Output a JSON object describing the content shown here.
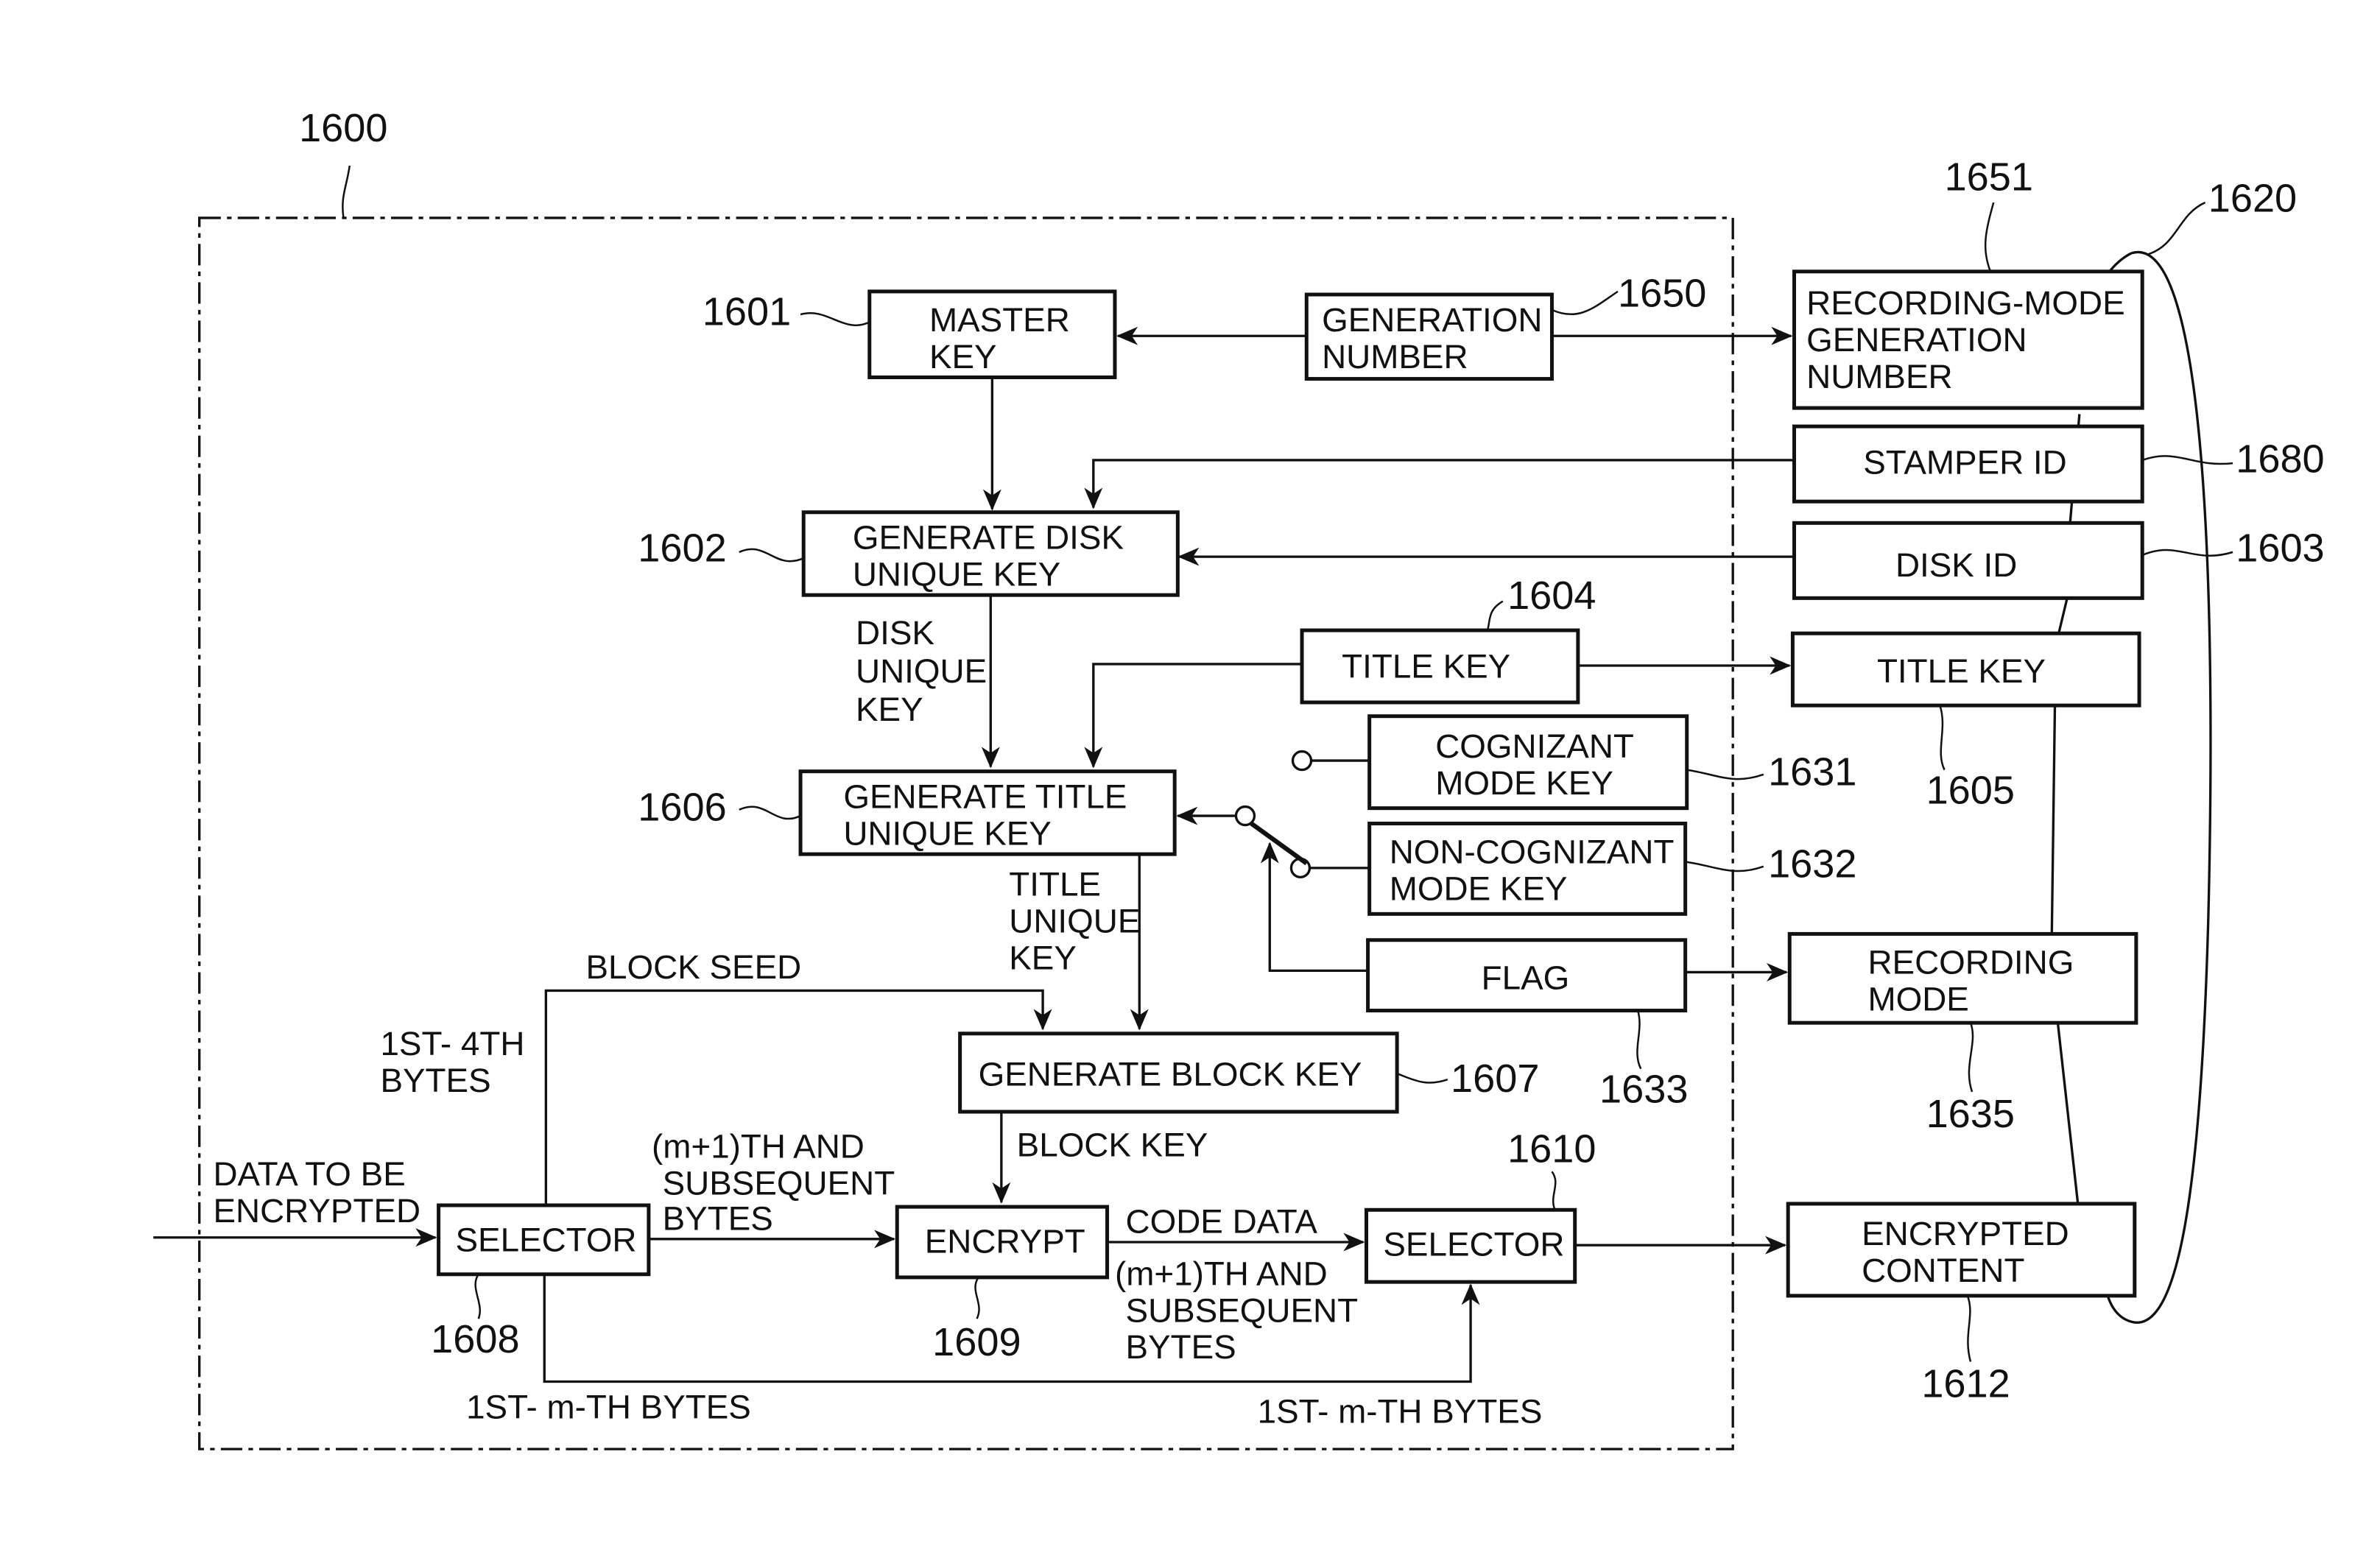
{
  "figure": {
    "container_ref": "1600",
    "disk_ref": "1620"
  },
  "blocks": {
    "master_key": {
      "lines": [
        "MASTER",
        "KEY"
      ],
      "ref": "1601"
    },
    "generation_number": {
      "lines": [
        "GENERATION",
        "NUMBER"
      ],
      "ref": "1650"
    },
    "gen_disk_unique_key": {
      "lines": [
        "GENERATE DISK",
        "UNIQUE KEY"
      ],
      "ref": "1602"
    },
    "title_key_inner": {
      "lines": [
        "TITLE  KEY"
      ],
      "ref": "1604"
    },
    "gen_title_unique_key": {
      "lines": [
        "GENERATE TITLE",
        "UNIQUE KEY"
      ],
      "ref": "1606"
    },
    "cognizant_mode_key": {
      "lines": [
        "COGNIZANT",
        "MODE KEY"
      ],
      "ref": "1631"
    },
    "non_cognizant_mode_key": {
      "lines": [
        "NON-COGNIZANT",
        "MODE KEY"
      ],
      "ref": "1632"
    },
    "flag": {
      "lines": [
        "FLAG"
      ],
      "ref": "1633"
    },
    "gen_block_key": {
      "lines": [
        "GENERATE BLOCK KEY"
      ],
      "ref": "1607"
    },
    "selector_in": {
      "lines": [
        "SELECTOR"
      ],
      "ref": "1608"
    },
    "encrypt": {
      "lines": [
        "ENCRYPT"
      ],
      "ref": "1609"
    },
    "selector_out": {
      "lines": [
        "SELECTOR"
      ],
      "ref": "1610"
    }
  },
  "disk_fields": {
    "recording_mode_generation_number": {
      "lines": [
        "RECORDING-MODE",
        "GENERATION",
        "NUMBER"
      ],
      "ref": "1651"
    },
    "stamper_id": {
      "lines": [
        "STAMPER ID"
      ],
      "ref": "1680"
    },
    "disk_id": {
      "lines": [
        "DISK ID"
      ],
      "ref": "1603"
    },
    "title_key": {
      "lines": [
        "TITLE KEY"
      ],
      "ref": "1605"
    },
    "recording_mode": {
      "lines": [
        "RECORDING",
        "MODE"
      ],
      "ref": "1635"
    },
    "encrypted_content": {
      "lines": [
        "ENCRYPTED",
        "CONTENT"
      ],
      "ref": "1612"
    }
  },
  "edge_labels": {
    "disk_unique_key": [
      "DISK",
      "UNIQUE",
      "KEY"
    ],
    "title_unique_key": [
      "TITLE",
      "UNIQUE",
      "KEY"
    ],
    "block_seed": "BLOCK SEED",
    "first_4th_bytes": [
      "1ST- 4TH",
      "BYTES"
    ],
    "data_to_be_encrypted": [
      "DATA TO BE",
      "ENCRYPTED"
    ],
    "m1_subsequent_in": [
      "(m+1)TH AND",
      "SUBSEQUENT",
      "BYTES"
    ],
    "block_key": "BLOCK KEY",
    "code_data": "CODE DATA",
    "m1_subsequent_out": [
      "(m+1)TH AND",
      "SUBSEQUENT",
      "BYTES"
    ],
    "first_m_bytes_left": "1ST- m-TH BYTES",
    "first_m_bytes_right": "1ST- m-TH BYTES"
  }
}
